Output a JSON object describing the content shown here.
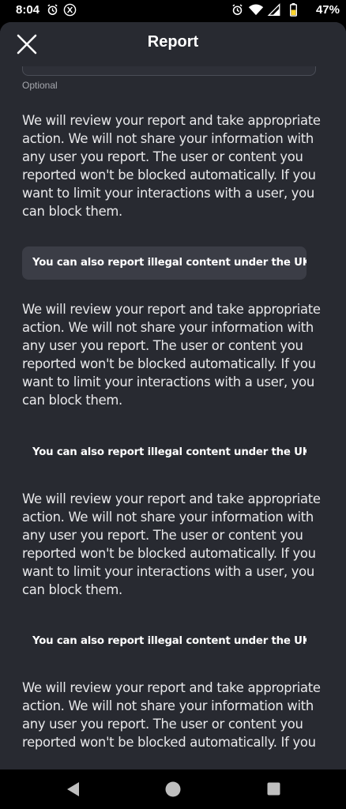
{
  "status_bar": {
    "time": "8:04",
    "battery": "47%"
  },
  "header": {
    "title": "Report"
  },
  "form": {
    "optional_label": "Optional"
  },
  "info_blocks": [
    {
      "text": "We will review your report and take appropriate action. We will not share your information with any user you report. The user or content you reported won't be blocked automatically. If you want to limit your interactions with a user, you can block them.",
      "link": "You can also report illegal content under the UK..."
    },
    {
      "text": "We will review your report and take appropriate action. We will not share your information with any user you report. The user or content you reported won't be blocked automatically. If you want to limit your interactions with a user, you can block them.",
      "link": "You can also report illegal content under the UK..."
    },
    {
      "text": "We will review your report and take appropriate action. We will not share your information with any user you report. The user or content you reported won't be blocked automatically. If you want to limit your interactions with a user, you can block them.",
      "link": "You can also report illegal content under the UK..."
    },
    {
      "text": "We will review your report and take appropriate action. We will not share your information with any user you report. The user or content you reported won't be blocked automatically. If you"
    }
  ],
  "colors": {
    "sheet_bg": "#282a31",
    "button_bg": "#3b3d46",
    "text": "#e8e8ea"
  }
}
